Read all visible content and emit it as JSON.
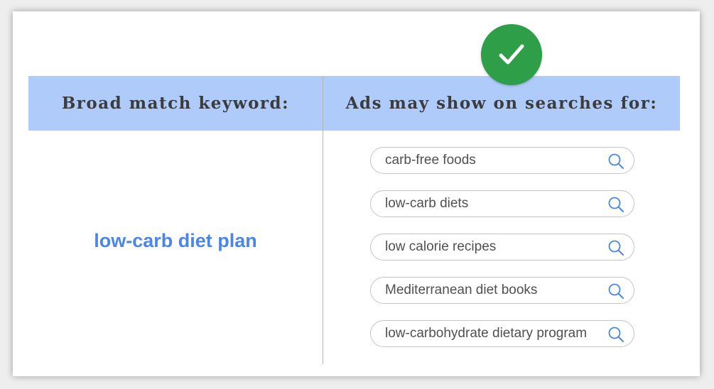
{
  "headers": {
    "left": "Broad match keyword:",
    "right": "Ads may show on searches for:"
  },
  "check_icon": "checkmark-icon",
  "keyword": "low-carb diet plan",
  "searches": [
    "carb-free foods",
    "low-carb diets",
    "low calorie recipes",
    "Mediterranean diet books",
    "low-carbohydrate dietary program"
  ],
  "search_icon": "search-icon",
  "colors": {
    "header_band": "#aecbfa",
    "keyword": "#4a86e8",
    "check": "#2e9e48",
    "search_icon": "#4a86e8"
  }
}
